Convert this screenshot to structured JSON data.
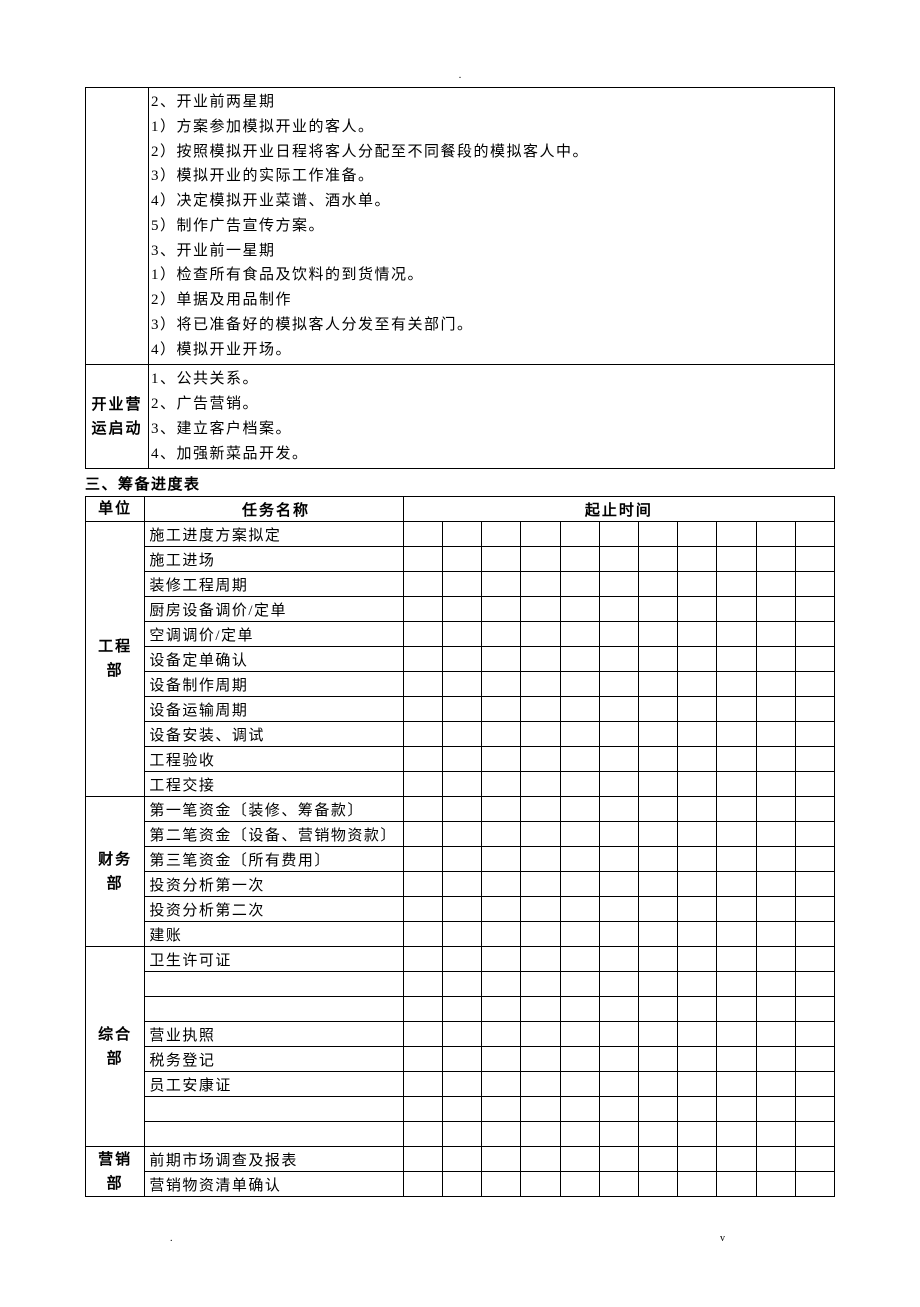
{
  "header_dot": ".",
  "top_stage_rows": [
    {
      "label": "",
      "lines": [
        "2、开业前两星期",
        "1）方案参加模拟开业的客人。",
        "2）按照模拟开业日程将客人分配至不同餐段的模拟客人中。",
        "3）模拟开业的实际工作准备。",
        "4）决定模拟开业菜谱、酒水单。",
        "5）制作广告宣传方案。",
        "3、开业前一星期",
        "1）检查所有食品及饮料的到货情况。",
        "2）单据及用品制作",
        "3）将已准备好的模拟客人分发至有关部门。",
        "4）模拟开业开场。"
      ]
    },
    {
      "label": "开业营运启动",
      "lines": [
        "1、公共关系。",
        "2、广告营销。",
        "3、建立客户档案。",
        "4、加强新菜品开发。"
      ]
    }
  ],
  "section3_title": "三、筹备进度表",
  "schedule_headers": {
    "unit": "单位",
    "task": "任务名称",
    "time": "起止时间"
  },
  "time_col_count": 11,
  "schedule_groups": [
    {
      "unit": "工程部",
      "tasks": [
        "施工进度方案拟定",
        "施工进场",
        "装修工程周期",
        "厨房设备调价/定单",
        "空调调价/定单",
        "设备定单确认",
        "设备制作周期",
        "设备运输周期",
        "设备安装、调试",
        "工程验收",
        "工程交接"
      ]
    },
    {
      "unit": "财务部",
      "tasks": [
        "第一笔资金〔装修、筹备款〕",
        "第二笔资金〔设备、营销物资款〕",
        "第三笔资金〔所有费用〕",
        "投资分析第一次",
        "投资分析第二次",
        "建账"
      ]
    },
    {
      "unit": "综合部",
      "tasks": [
        "卫生许可证",
        "",
        "",
        "营业执照",
        "税务登记",
        "员工安康证",
        "",
        ""
      ]
    },
    {
      "unit": "营销部",
      "tasks": [
        "前期市场调查及报表",
        "营销物资清单确认"
      ]
    }
  ],
  "footer_dot": ".",
  "footer_v": "v"
}
